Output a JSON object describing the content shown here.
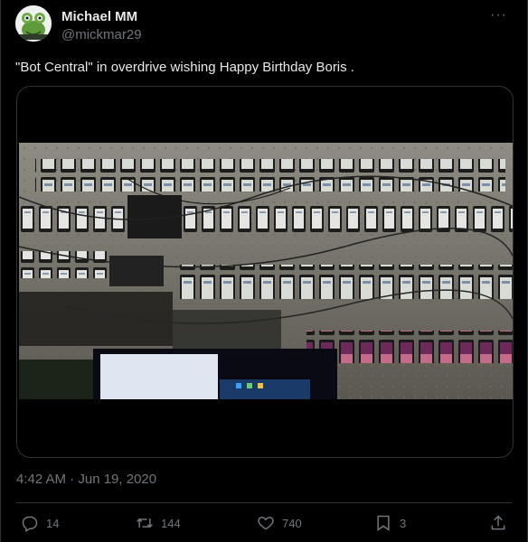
{
  "author": {
    "display_name": "Michael MM",
    "handle": "@mickmar29",
    "avatar_icon": "frog-avatar-icon"
  },
  "menu": {
    "more_label": "···"
  },
  "tweet": {
    "text": "\"Bot Central\" in overdrive wishing Happy Birthday Boris .",
    "timestamp": "4:42 AM · Jun 19, 2020"
  },
  "media": {
    "description_icon": "photo-of-phone-farm"
  },
  "actions": {
    "replies": "14",
    "retweets": "144",
    "likes": "740",
    "bookmarks": "3"
  },
  "colors": {
    "background": "#000000",
    "text_primary": "#e7e9ea",
    "text_secondary": "#71767b",
    "border": "#2f3336"
  }
}
